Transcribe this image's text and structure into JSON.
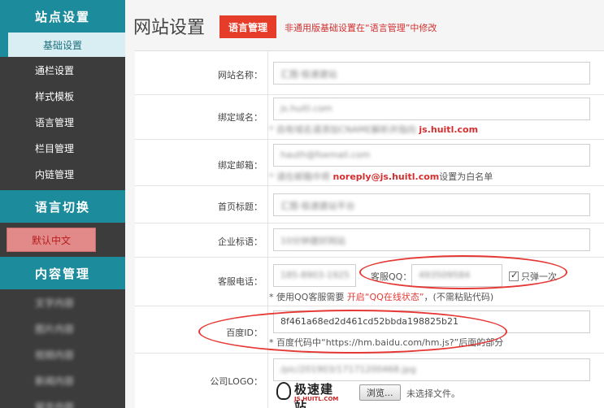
{
  "sidebar": {
    "sections": [
      {
        "title": "站点设置"
      },
      {
        "title": "语言切换"
      },
      {
        "title": "内容管理"
      }
    ],
    "site_items": [
      "基础设置",
      "通栏设置",
      "样式模板",
      "语言管理",
      "栏目管理",
      "内链管理"
    ],
    "lang_default": "默认中文",
    "content_items": [
      "文字内容",
      "图片内容",
      "视频内容",
      "新闻内容",
      "留言内容"
    ]
  },
  "header": {
    "title": "网站设置",
    "lang_button": "语言管理",
    "note": "非通用版基础设置在“语言管理”中修改"
  },
  "form": {
    "site_name": {
      "label": "网站名称：",
      "value": "汇图·极速建站"
    },
    "domain": {
      "label": "绑定域名：",
      "value": "js.huitl.com",
      "hint_prefix": "* 自有域名请添加CNAME解析并指向 ",
      "hint_domain": "js.huitl.com"
    },
    "email": {
      "label": "绑定邮箱：",
      "value": "hauth@foxmail.com",
      "hint_prefix": "* 请在邮箱中将 ",
      "hint_email": "noreply@js.huitl.com",
      "hint_suffix": "设置为白名单"
    },
    "home_title": {
      "label": "首页标题：",
      "value": "汇图·极速建站平台"
    },
    "slogan": {
      "label": "企业标语：",
      "value": "10分钟建好网站"
    },
    "service_phone": {
      "label": "客服电话：",
      "value": "185-8903-1925",
      "qq_label": "客服QQ：",
      "qq_value": "493509584",
      "popup_label": "只弹一次",
      "hint_prefix": "* 使用QQ客服需要 ",
      "hint_red": "开启“QQ在线状态”",
      "hint_suffix": "，(不需粘贴代码)"
    },
    "baidu_id": {
      "label": "百度ID：",
      "value": "8f461a68ed2d461cd52bbda198825b21",
      "hint": "* 百度代码中“https://hm.baidu.com/hm.js?”后面的部分"
    },
    "company_logo": {
      "label": "公司LOGO：",
      "value": "/pic/201903/17171200468.jpg",
      "browse_label": "浏览...",
      "file_status": "未选择文件。"
    }
  },
  "watermark": {
    "text": "极速建站",
    "url": "JS.HUITL.COM"
  },
  "colors": {
    "teal": "#1c8b9b",
    "sidebar_bg": "#3c3c3c",
    "red": "#e53935"
  }
}
